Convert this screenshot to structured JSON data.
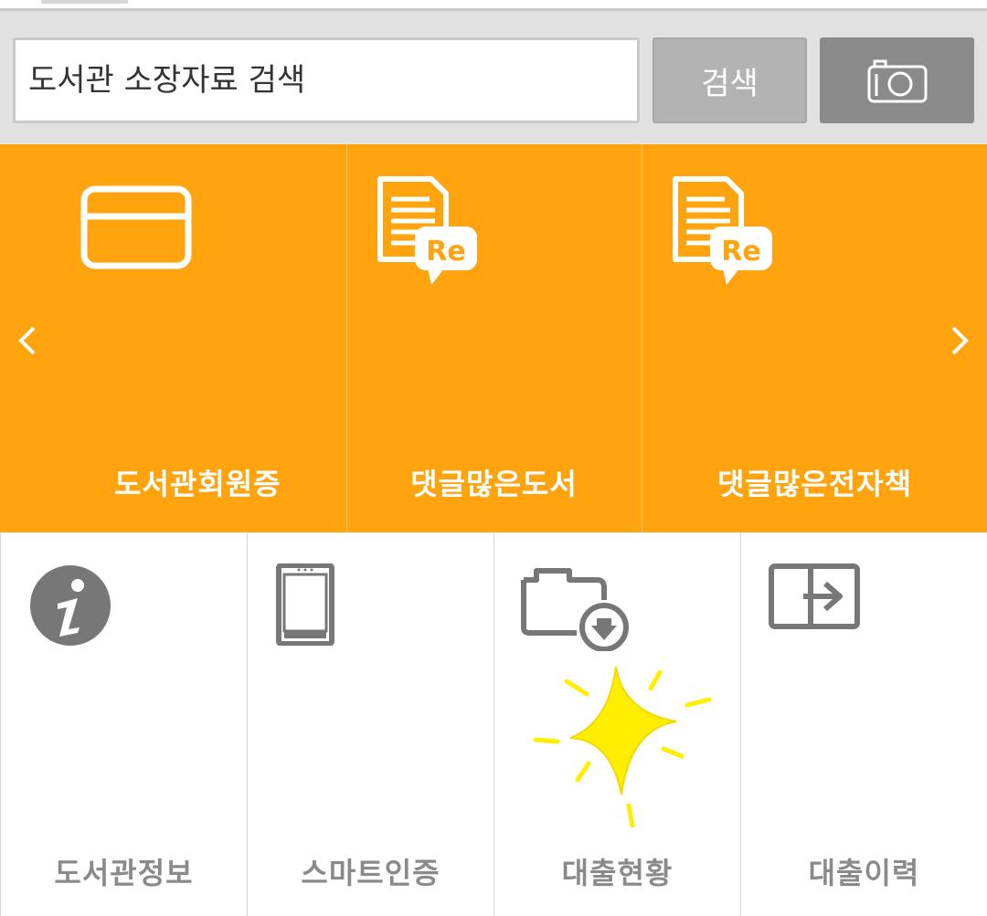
{
  "search": {
    "placeholder": "도서관 소장자료 검색",
    "button_label": "검색"
  },
  "icons": {
    "camera": "camera-icon",
    "card": "card-icon",
    "review_book": "document-reply-icon",
    "review_ebook": "document-reply-icon",
    "info": "info-icon",
    "phone": "smartphone-icon",
    "loan_status": "folder-download-icon",
    "loan_history": "return-arrow-icon",
    "arrow_left": "chevron-left-icon",
    "arrow_right": "chevron-right-icon",
    "sparkle": "sparkle-icon"
  },
  "orange_menu": {
    "items": [
      {
        "label": "도서관회원증"
      },
      {
        "label": "댓글많은도서"
      },
      {
        "label": "댓글많은전자책"
      }
    ]
  },
  "white_menu": {
    "items": [
      {
        "label": "도서관정보"
      },
      {
        "label": "스마트인증"
      },
      {
        "label": "대출현황"
      },
      {
        "label": "대출이력"
      }
    ]
  },
  "colors": {
    "orange": "#ffa40e",
    "search_bg": "#e1e1e1",
    "search_button": "#b3b3b3",
    "camera_button": "#8a8a8a",
    "icon_gray": "#777777",
    "sparkle": "#ffee00"
  }
}
